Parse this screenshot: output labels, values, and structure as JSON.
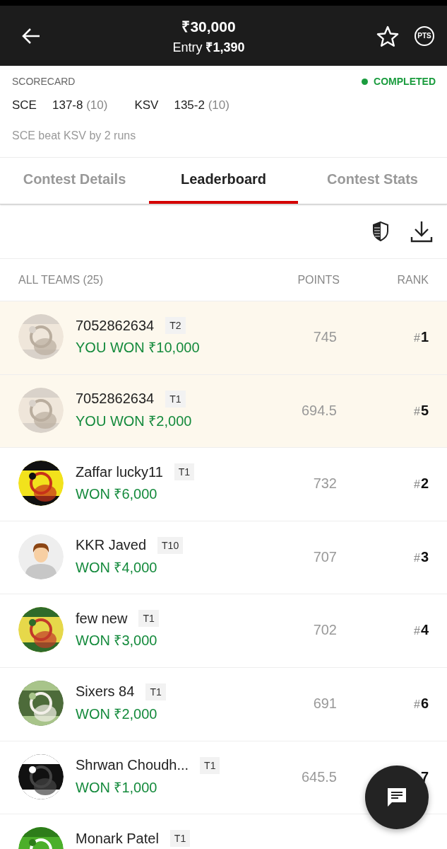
{
  "header": {
    "prize": "₹30,000",
    "entry_label": "Entry",
    "entry_amount": "₹1,390",
    "points_badge": "PTS"
  },
  "scorecard": {
    "title": "SCORECARD",
    "status": "COMPLETED",
    "teams": [
      {
        "name": "SCE",
        "score": "137-8",
        "overs": "(10)"
      },
      {
        "name": "KSV",
        "score": "135-2",
        "overs": "(10)"
      }
    ],
    "result": "SCE beat KSV by 2 runs"
  },
  "tabs": [
    {
      "label": "Contest Details",
      "selected": false
    },
    {
      "label": "Leaderboard",
      "selected": true
    },
    {
      "label": "Contest Stats",
      "selected": false
    }
  ],
  "leaderboard": {
    "columns": [
      "ALL TEAMS (25)",
      "POINTS",
      "RANK"
    ],
    "rows": [
      {
        "kind": "picture",
        "name": "7052862634",
        "team": "T2",
        "prize": "YOU WON ₹10,000",
        "points": "745",
        "rank_mark": "#",
        "rank": "1",
        "mine": true
      },
      {
        "kind": "picture",
        "name": "7052862634",
        "team": "T1",
        "prize": "YOU WON ₹2,000",
        "points": "694.5",
        "rank_mark": "#",
        "rank": "5",
        "mine": true
      },
      {
        "kind": "picture",
        "name": "Zaffar lucky11",
        "team": "T1",
        "prize": "WON ₹6,000",
        "points": "732",
        "rank_mark": "#",
        "rank": "2",
        "mine": false
      },
      {
        "kind": "default",
        "name": "KKR Javed",
        "team": "T10",
        "prize": "WON ₹4,000",
        "points": "707",
        "rank_mark": "#",
        "rank": "3",
        "mine": false
      },
      {
        "kind": "picture",
        "name": "few new",
        "team": "T1",
        "prize": "WON ₹3,000",
        "points": "702",
        "rank_mark": "#",
        "rank": "4",
        "mine": false
      },
      {
        "kind": "picture",
        "name": "Sixers 84",
        "team": "T1",
        "prize": "WON ₹2,000",
        "points": "691",
        "rank_mark": "#",
        "rank": "6",
        "mine": false
      },
      {
        "kind": "picture",
        "name": "Shrwan Choudh...",
        "team": "T1",
        "prize": "WON ₹1,000",
        "points": "645.5",
        "rank": "7",
        "mine": false
      },
      {
        "kind": "picture",
        "name": "Monark Patel",
        "team": "T1",
        "mine": false
      }
    ]
  }
}
